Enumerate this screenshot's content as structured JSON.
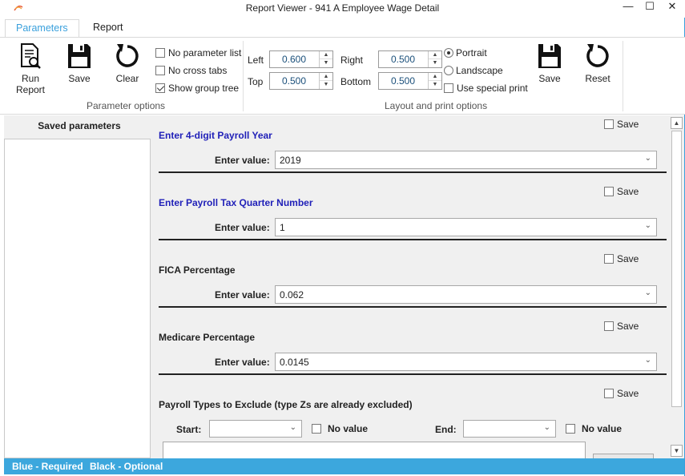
{
  "window": {
    "title": "Report Viewer - 941 A Employee Wage Detail",
    "minimize": "—",
    "maximize": "☐",
    "close": "✕"
  },
  "tabs": [
    {
      "label": "Parameters",
      "active": true
    },
    {
      "label": "Report",
      "active": false
    }
  ],
  "ribbon": {
    "run_report": "Run\nReport",
    "save": "Save",
    "clear": "Clear",
    "options": {
      "no_parameter_list": {
        "label": "No parameter list",
        "checked": false
      },
      "no_cross_tabs": {
        "label": "No cross tabs",
        "checked": false
      },
      "show_group_tree": {
        "label": "Show group tree",
        "checked": true
      }
    },
    "parameter_options_label": "Parameter options",
    "margins": {
      "left_label": "Left",
      "left_value": "0.600",
      "top_label": "Top",
      "top_value": "0.500",
      "right_label": "Right",
      "right_value": "0.500",
      "bottom_label": "Bottom",
      "bottom_value": "0.500"
    },
    "orientation": {
      "portrait": {
        "label": "Portrait",
        "selected": true
      },
      "landscape": {
        "label": "Landscape",
        "selected": false
      }
    },
    "use_special_print": {
      "label": "Use special print",
      "checked": false
    },
    "layout_save": "Save",
    "layout_reset": "Reset",
    "layout_print_options_label": "Layout and print options"
  },
  "saved_parameters": {
    "header": "Saved parameters",
    "items": []
  },
  "parameters": [
    {
      "name": "Enter 4-digit Payroll Year",
      "required": true,
      "save_label": "Save",
      "enter_label": "Enter value:",
      "value": "2019"
    },
    {
      "name": "Enter Payroll Tax Quarter Number",
      "required": true,
      "save_label": "Save",
      "enter_label": "Enter value:",
      "value": "1"
    },
    {
      "name": "FICA Percentage",
      "required": false,
      "save_label": "Save",
      "enter_label": "Enter value:",
      "value": "0.062"
    },
    {
      "name": "Medicare Percentage",
      "required": false,
      "save_label": "Save",
      "enter_label": "Enter value:",
      "value": "0.0145"
    }
  ],
  "payroll_types": {
    "name": "Payroll Types to Exclude (type Zs are already excluded)",
    "save_label": "Save",
    "start_label": "Start:",
    "end_label": "End:",
    "no_value_label": "No value"
  },
  "status": {
    "blue": "Blue - Required",
    "black": "Black - Optional"
  },
  "colors": {
    "accent": "#3ca7dd",
    "required_text": "#1f1fb8"
  }
}
